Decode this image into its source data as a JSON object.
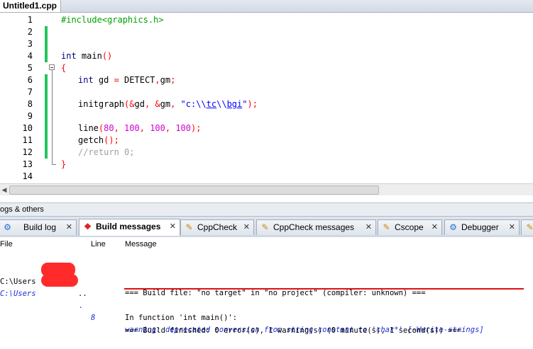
{
  "editor": {
    "file_tab": "Untitled1.cpp",
    "line_numbers": [
      "1",
      "2",
      "3",
      "4",
      "5",
      "6",
      "7",
      "8",
      "9",
      "10",
      "11",
      "12",
      "13",
      "14"
    ]
  },
  "code": {
    "l1": "#include<graphics.h>",
    "l4_kw": "int",
    "l4_rest": " main",
    "l4_paren": "()",
    "l5": "{",
    "l6_kw": "int",
    "l6_a": " gd ",
    "l6_eq": "=",
    "l6_b": " DETECT",
    "l6_c": ",",
    "l6_d": "gm",
    "l6_e": ";",
    "l8_a": "initgraph",
    "l8_b": "(&",
    "l8_c": "gd",
    "l8_d": ", &",
    "l8_e": "gm",
    "l8_f": ", ",
    "l8_s1": "\"c:\\\\",
    "l8_s2": "tc",
    "l8_s3": "\\\\",
    "l8_s4": "bgi",
    "l8_s5": "\"",
    "l8_g": ");",
    "l10_a": "line",
    "l10_b": "(",
    "l10_n1": "80",
    "l10_c": ", ",
    "l10_n2": "100",
    "l10_d": ", ",
    "l10_n3": "100",
    "l10_e": ", ",
    "l10_n4": "100",
    "l10_f": ");",
    "l11_a": "getch",
    "l11_b": "();",
    "l12": "//return 0;",
    "l13": "}"
  },
  "logs": {
    "panel_title": "ogs & others",
    "tabs": [
      {
        "label": "Build log",
        "icon": "gear-icon"
      },
      {
        "label": "Build messages",
        "icon": "bug-icon"
      },
      {
        "label": "CppCheck",
        "icon": "pencil-icon"
      },
      {
        "label": "CppCheck messages",
        "icon": "pencil-icon"
      },
      {
        "label": "Cscope",
        "icon": "pencil-icon"
      },
      {
        "label": "Debugger",
        "icon": "gear-icon"
      }
    ],
    "columns": {
      "file": "File",
      "line": "Line",
      "message": "Message"
    },
    "rows": [
      {
        "file": "",
        "line": "",
        "message": "=== Build file: \"no target\" in \"no project\" (compiler: unknown) ==="
      },
      {
        "file": "C:\\Users",
        "file_tail": "..",
        "line": "",
        "message": "In function 'int main()':"
      },
      {
        "file": "C:\\Users",
        "file_tail": ".",
        "line": "8",
        "message": "warning: deprecated conversion from string constant to 'char*' [-Wwrite-strings]"
      },
      {
        "file": "",
        "line": "",
        "message": "=== Build finished: 0 error(s), 1 warning(s) (0 minute(s), 1 second(s)) ==="
      }
    ]
  },
  "colors": {
    "change_bar": "#22c55e",
    "preprocessor": "#00a000",
    "keyword": "#000080",
    "number": "#d000d0",
    "string": "#0000ff",
    "warning_text": "#1c2fd6",
    "annotation_red": "#e01010"
  }
}
